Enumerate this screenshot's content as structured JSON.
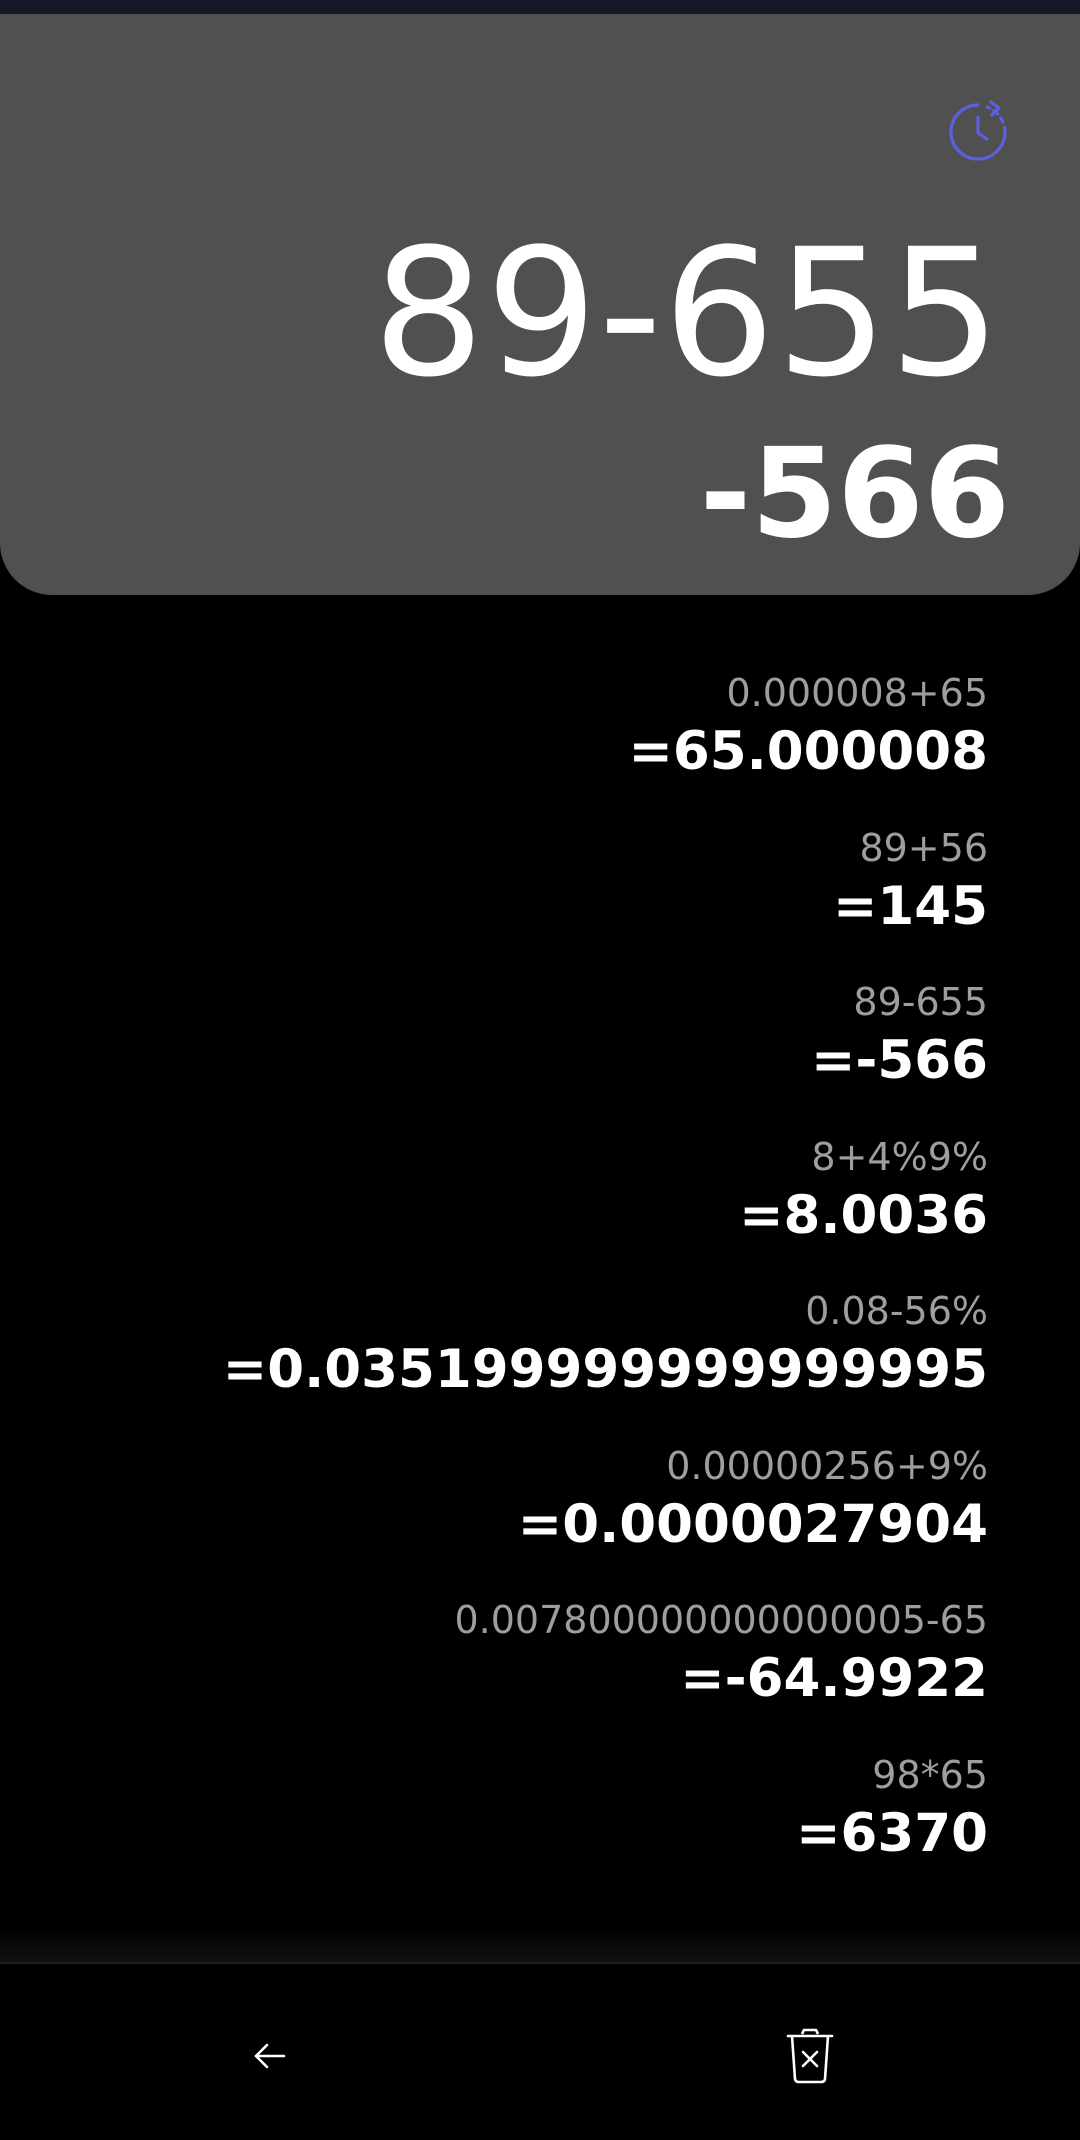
{
  "display": {
    "expression": "89-655",
    "result": "-566"
  },
  "history": [
    {
      "expression": "0.000008+65",
      "result": "=65.000008"
    },
    {
      "expression": "89+56",
      "result": "=145"
    },
    {
      "expression": "89-655",
      "result": "=-566"
    },
    {
      "expression": "8+4%9%",
      "result": "=8.0036"
    },
    {
      "expression": "0.08-56%",
      "result": "=0.035199999999999995"
    },
    {
      "expression": "0.00000256+9%",
      "result": "=0.0000027904"
    },
    {
      "expression": "0.007800000000000005-65",
      "result": "=-64.9922"
    },
    {
      "expression": "98*65",
      "result": "=6370"
    }
  ],
  "icons": {
    "history": "history-clock-icon",
    "back": "arrow-left-icon",
    "clear": "trash-clear-icon"
  },
  "colors": {
    "display_bg": "#505050",
    "accent": "#5b5fe0",
    "history_expr": "#9e9e9e"
  }
}
